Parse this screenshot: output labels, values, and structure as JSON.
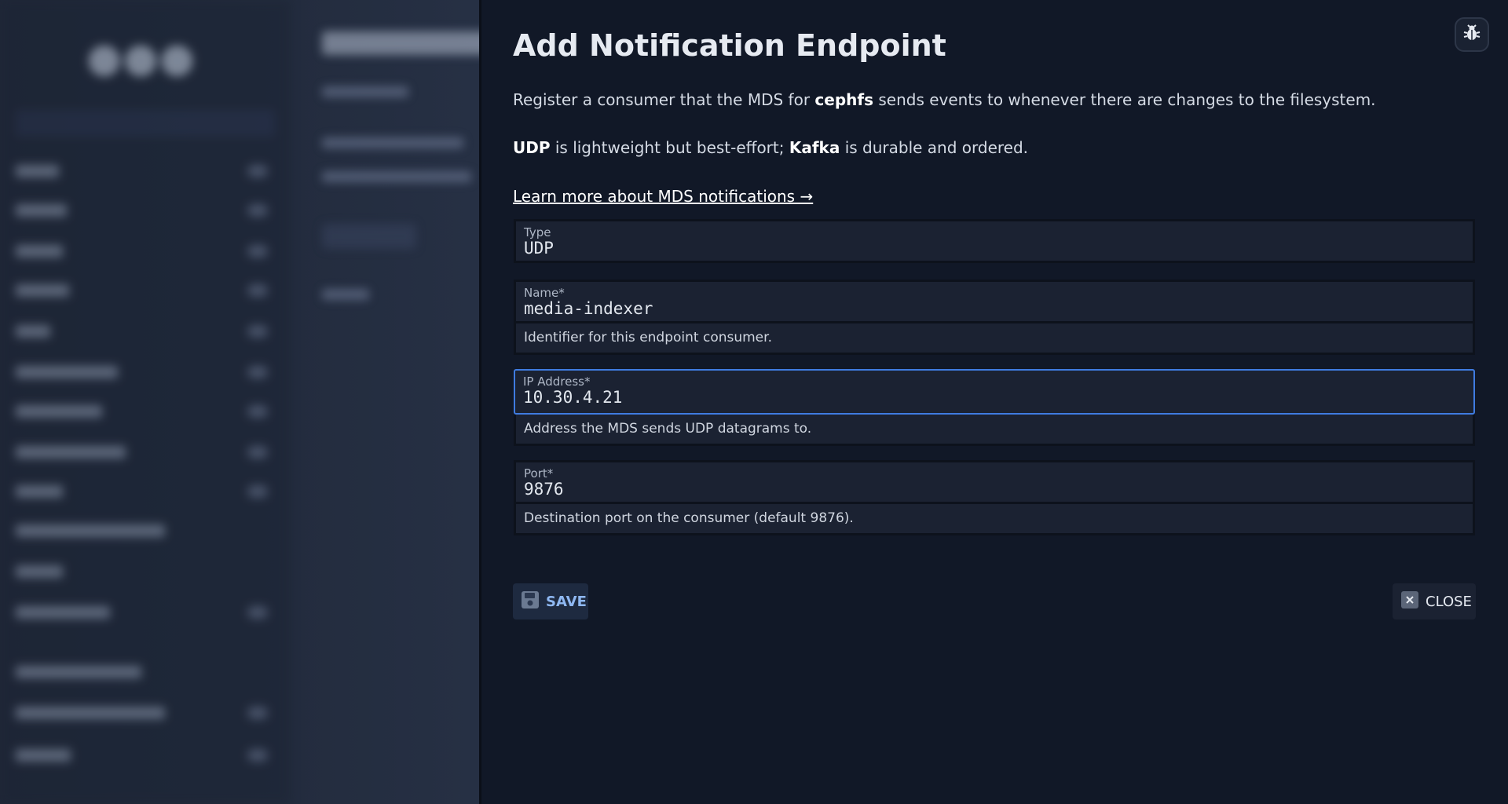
{
  "dialog": {
    "title": "Add Notification Endpoint",
    "intro_before": "Register a consumer that the MDS for ",
    "intro_fs": "cephfs",
    "intro_after": " sends events to whenever there are changes to the filesystem.",
    "transport_udp": "UDP",
    "transport_mid": " is lightweight but best-effort; ",
    "transport_kafka": "Kafka",
    "transport_end": " is durable and ordered.",
    "learn_more": "Learn more about MDS notifications →"
  },
  "form": {
    "type": {
      "label": "Type",
      "value": "UDP"
    },
    "name": {
      "label": "Name*",
      "value": "media-indexer",
      "helper": "Identifier for this endpoint consumer."
    },
    "ip": {
      "label": "IP Address*",
      "value": "10.30.4.21",
      "helper": "Address the MDS sends UDP datagrams to."
    },
    "port": {
      "label": "Port*",
      "value": "9876",
      "helper": "Destination port on the consumer (default 9876)."
    }
  },
  "actions": {
    "save": "SAVE",
    "close": "CLOSE"
  },
  "icons": {
    "bug": "bug-icon",
    "save": "floppy-disk-icon",
    "close": "close-x-icon"
  },
  "colors": {
    "accent": "#3f7be0",
    "panel": "#111827",
    "save_text": "#8fb8f2"
  }
}
